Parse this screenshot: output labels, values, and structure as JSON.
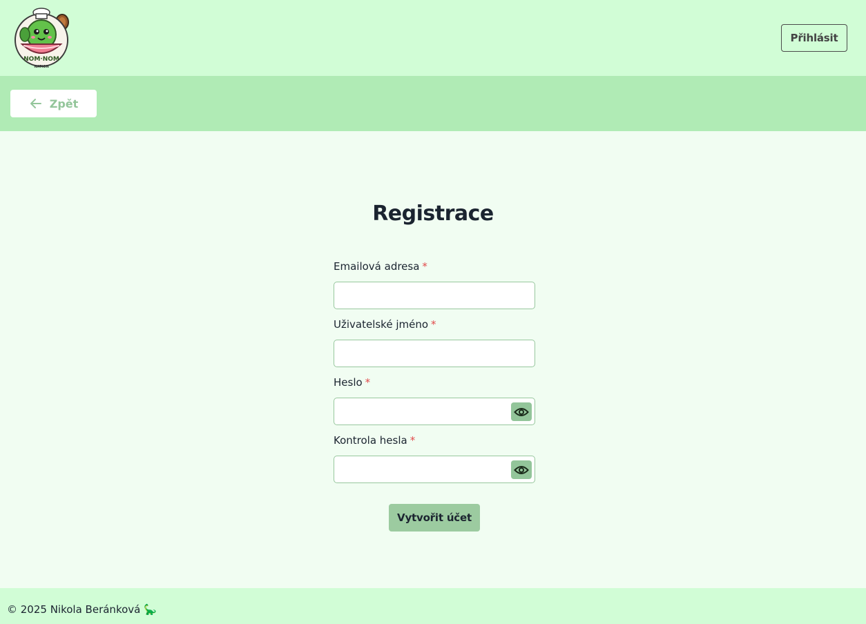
{
  "header": {
    "logo_text": "NOM·NOM NATION",
    "login_label": "Přihlásit"
  },
  "subnav": {
    "back_label": "Zpět"
  },
  "form": {
    "title": "Registrace",
    "required_marker": "*",
    "fields": [
      {
        "label": "Emailová adresa",
        "value": "",
        "type": "email"
      },
      {
        "label": "Uživatelské jméno",
        "value": "",
        "type": "text"
      },
      {
        "label": "Heslo",
        "value": "",
        "type": "password"
      },
      {
        "label": "Kontrola hesla",
        "value": "",
        "type": "password"
      }
    ],
    "submit_label": "Vytvořit účet"
  },
  "footer": {
    "text": "© 2025 Nikola Beránková 🦕"
  },
  "colors": {
    "topbar": "#d1fdd6",
    "subbar": "#b0ebb5",
    "page_bg": "#f1fdf2",
    "accent": "#93c59a",
    "required": "#e24b4b"
  }
}
